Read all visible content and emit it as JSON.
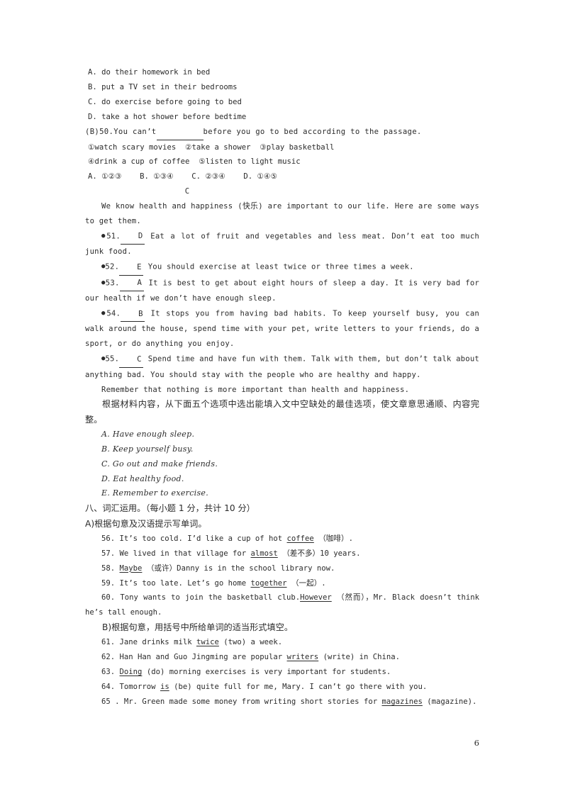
{
  "document": {
    "page_number": "6",
    "answer_mark_c": "C"
  },
  "mc_options_q49": [
    "A. do their homework in bed",
    "B. put a TV set in their bedrooms",
    "C. do exercise before going to bed",
    "D. take a hot shower before bedtime"
  ],
  "question_50": {
    "answer_tag": "(B)",
    "number": "50.",
    "text_before_blank": "You can’t",
    "text_after_blank": "before you go to bed according to the passage.",
    "items_line1": "①watch scary movies  ②take a shower  ③play basketball",
    "items_line2": "④drink a cup of coffee  ⑤listen to light music",
    "choices": "A. ①②③    B. ①③④    C. ②③④    D. ①④⑤"
  },
  "passage": {
    "intro": "We know health and happiness (快乐) are important to our life. Here are some ways to get them.",
    "items": [
      {
        "number": "51.",
        "answer": "D",
        "text": "Eat a lot of fruit and vegetables and less meat. Don’t eat too much junk food."
      },
      {
        "number": "52.",
        "answer": "E",
        "text": "You should exercise at least twice or three times a week."
      },
      {
        "number": "53.",
        "answer": "A",
        "text": "It is best to get about eight hours of sleep a day. It is very bad for our health if we don’t have enough sleep."
      },
      {
        "number": "54.",
        "answer": "B",
        "text": "It stops you from having bad habits. To keep yourself busy, you can walk around the house, spend time with your pet, write letters to your friends, do a sport, or do anything you enjoy."
      },
      {
        "number": "55.",
        "answer": "C",
        "text": "Spend time and have fun with them. Talk with them, but don’t talk about anything bad. You should stay with the people who are healthy and happy."
      }
    ],
    "closing": "Remember that nothing is more important than health and happiness.",
    "instruction_cn": "根据材料内容，从下面五个选项中选出能填入文中空缺处的最佳选项，使文章意思通顺、内容完整。",
    "lettered_options": [
      "A. Have enough sleep.",
      "B. Keep yourself busy.",
      "C. Go out and make friends.",
      "D. Eat healthy food.",
      "E. Remember to exercise."
    ]
  },
  "section_eight": {
    "heading": "八、词汇运用。（每小题 1 分，共计 10 分）",
    "part_a_heading": "A)根据句意及汉语提示写单词。",
    "part_a_items": [
      {
        "number": "56.",
        "before": "It’s too cold. I’d like a cup of hot",
        "answer": "coffee",
        "after": "（咖啡）."
      },
      {
        "number": "57.",
        "before": "We lived in that village for",
        "answer": "almost",
        "after": "（差不多）10 years."
      },
      {
        "number": "58.",
        "before": "",
        "answer": "Maybe",
        "after": "（或许）Danny is in the school library now."
      },
      {
        "number": "59.",
        "before": "It’s too late. Let’s go home",
        "answer": "together",
        "after": "（一起）."
      },
      {
        "number": "60.",
        "before": "Tony wants to join the basketball club.",
        "answer": "However",
        "after": "（然而），Mr. Black doesn’t think he’s tall enough."
      }
    ],
    "part_b_heading": "B)根据句意，用括号中所给单词的适当形式填空。",
    "part_b_items": [
      {
        "number": "61.",
        "before": "Jane drinks milk",
        "answer": "twice",
        "after": "(two) a week."
      },
      {
        "number": "62.",
        "before": "Han Han and Guo Jingming are popular",
        "answer": "writers",
        "after": "(write) in China."
      },
      {
        "number": "63.",
        "before": "",
        "answer": "Doing",
        "after": "(do) morning exercises is very important for students."
      },
      {
        "number": "64.",
        "before": "Tomorrow",
        "answer": "is",
        "after": "(be) quite full for me, Mary. I can’t go there with you."
      },
      {
        "number": "65 .",
        "before": "Mr. Green made some money from writing short stories for",
        "answer": "magazines",
        "after": "(magazine)."
      }
    ]
  }
}
